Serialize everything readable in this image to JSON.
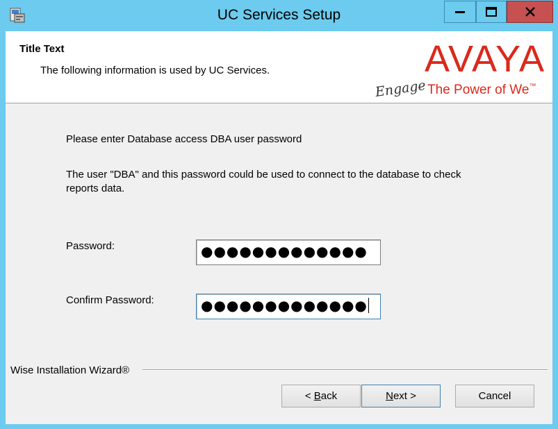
{
  "window": {
    "title": "UC Services Setup",
    "controls": [
      "minimize",
      "maximize",
      "close"
    ]
  },
  "header": {
    "title": "Title Text",
    "subtitle": "The following information is used by UC Services.",
    "logo_text": "AVAYA",
    "tagline_script": "Engage",
    "tagline": "The Power of We",
    "tagline_tm": "™"
  },
  "form": {
    "prompt": "Please enter Database access DBA user password",
    "note": "The user \"DBA\" and this password could be used to connect to the database to check reports data.",
    "password_label": "Password:",
    "password_value": "●●●●●●●●●●●●●",
    "confirm_label": "Confirm Password:",
    "confirm_value": "●●●●●●●●●●●●●"
  },
  "footer": {
    "wizard_label": "Wise Installation Wizard®",
    "back_prefix": "< ",
    "back_accel": "B",
    "back_rest": "ack",
    "next_accel": "N",
    "next_rest": "ext >",
    "cancel_label": "Cancel"
  },
  "colors": {
    "titlebar": "#6ccbee",
    "close": "#c75050",
    "brand": "#da291c"
  },
  "icons": [
    "setup-app-icon",
    "minimize-icon",
    "maximize-icon",
    "close-icon"
  ]
}
